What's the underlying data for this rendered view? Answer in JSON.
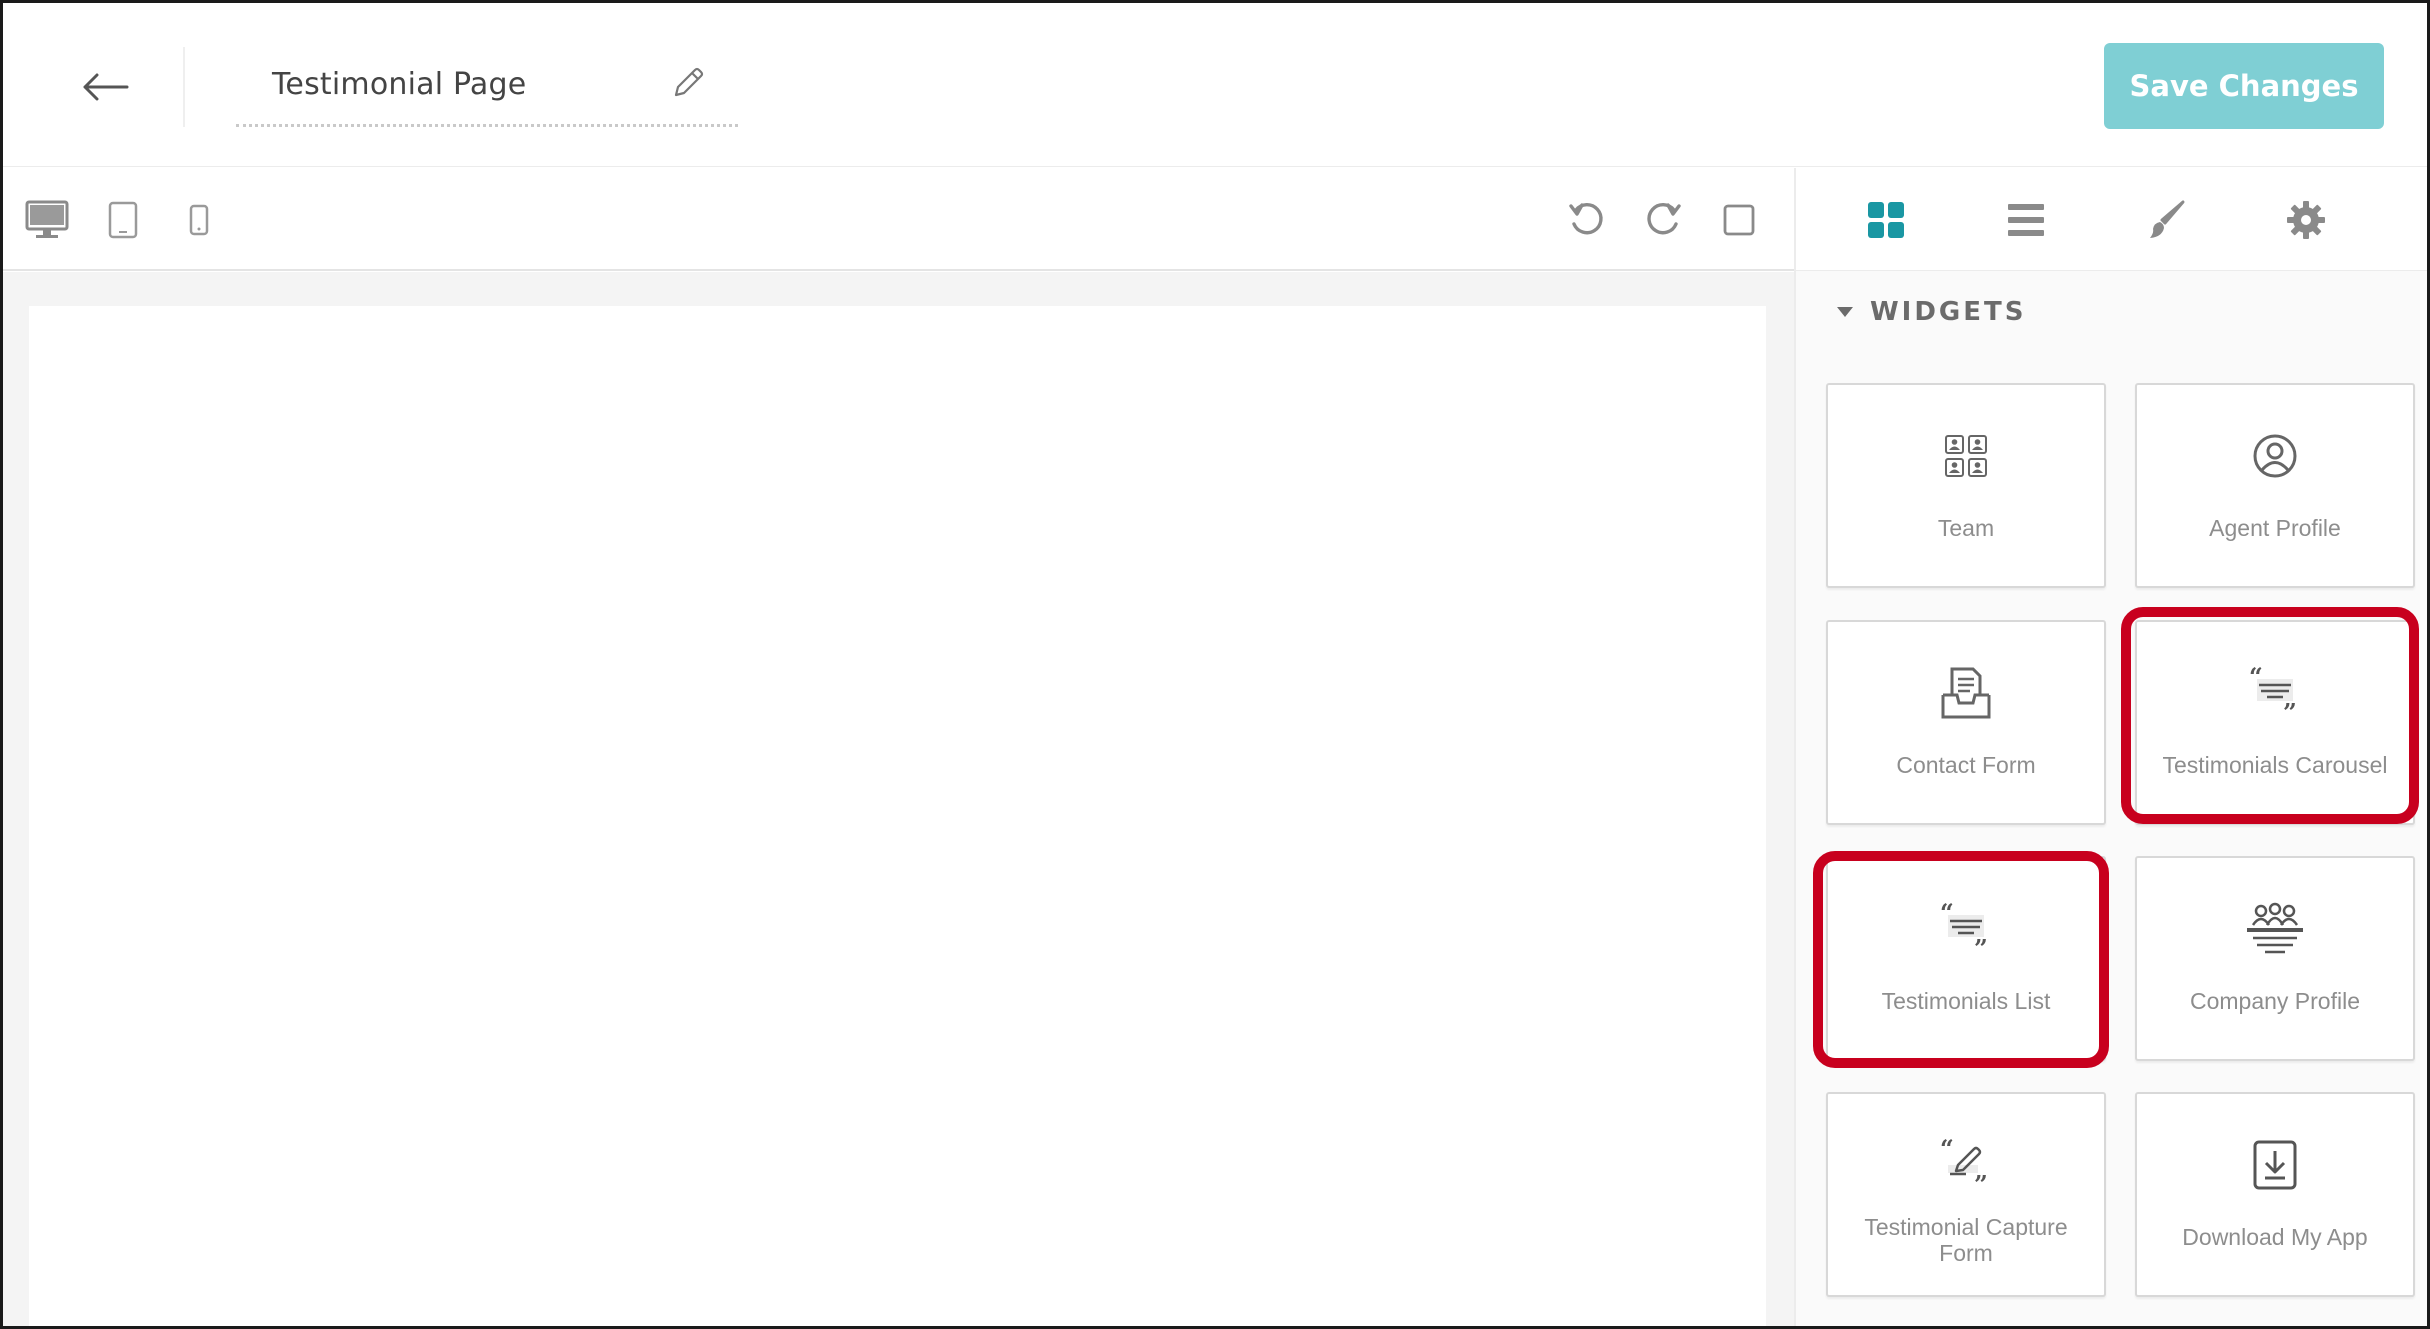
{
  "header": {
    "page_title": "Testimonial Page",
    "save_label": "Save Changes"
  },
  "toolbar": {
    "devices": [
      "desktop",
      "tablet",
      "mobile"
    ],
    "actions": [
      "undo",
      "redo",
      "fullscreen"
    ]
  },
  "panel": {
    "tabs": [
      "widgets-grid",
      "layers-list",
      "style-brush",
      "settings-gear"
    ],
    "active_tab": "widgets-grid",
    "widgets_title": "WIDGETS",
    "widgets": [
      {
        "label": "Team",
        "icon": "team-grid-icon"
      },
      {
        "label": "Agent Profile",
        "icon": "user-circle-icon"
      },
      {
        "label": "Contact Form",
        "icon": "inbox-tray-icon"
      },
      {
        "label": "Testimonials Carousel",
        "icon": "quote-lines-icon"
      },
      {
        "label": "Testimonials List",
        "icon": "quote-lines-icon"
      },
      {
        "label": "Company Profile",
        "icon": "group-podium-icon"
      },
      {
        "label": "Testimonial Capture Form",
        "icon": "quote-pen-icon"
      },
      {
        "label": "Download My App",
        "icon": "download-box-icon"
      }
    ],
    "highlighted": [
      "Testimonials Carousel",
      "Testimonials List"
    ]
  },
  "colors": {
    "accent": "#7fcfd4",
    "active_tab": "#1a97a3",
    "highlight": "#c8001e",
    "icon_gray": "#777777"
  }
}
